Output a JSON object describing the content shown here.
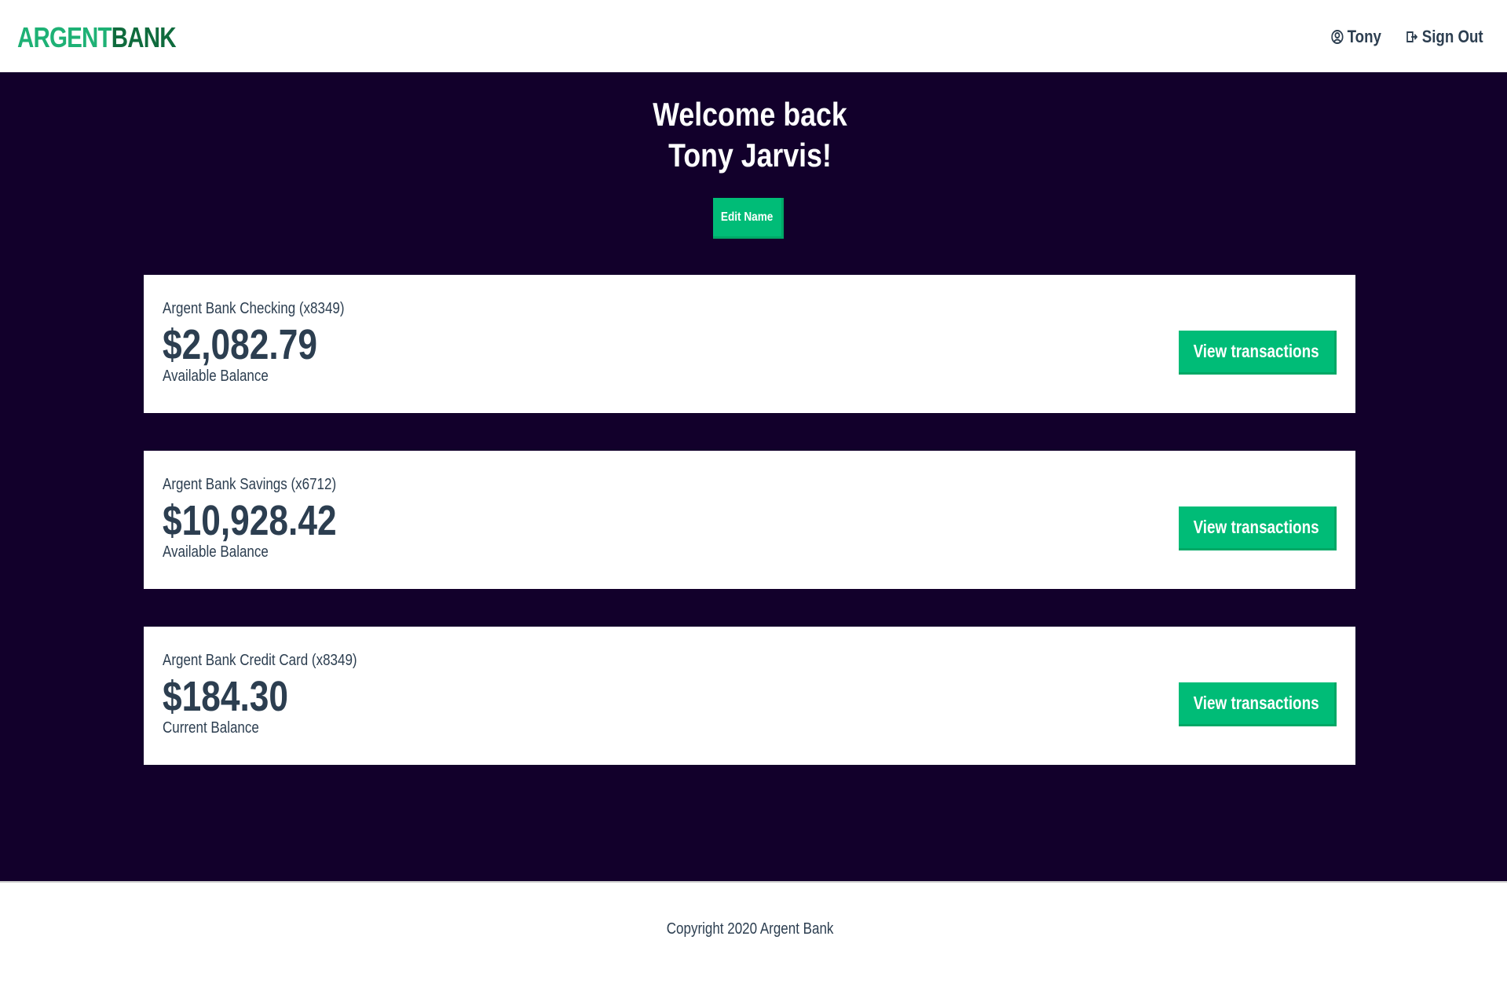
{
  "brand": {
    "logo_part1": "ARGENT",
    "logo_part2": "BANK",
    "accent_color": "#00bc77",
    "background_color": "#12002b"
  },
  "header": {
    "user_label": "Tony",
    "user_icon": "user-circle-icon",
    "sign_out_label": "Sign Out",
    "sign_out_icon": "sign-out-icon"
  },
  "welcome": {
    "line1": "Welcome back",
    "line2": "Tony Jarvis!",
    "edit_button_label": "Edit Name"
  },
  "accounts": [
    {
      "title": "Argent Bank Checking (x8349)",
      "amount": "$2,082.79",
      "description": "Available Balance",
      "button_label": "View transactions"
    },
    {
      "title": "Argent Bank Savings (x6712)",
      "amount": "$10,928.42",
      "description": "Available Balance",
      "button_label": "View transactions"
    },
    {
      "title": "Argent Bank Credit Card (x8349)",
      "amount": "$184.30",
      "description": "Current Balance",
      "button_label": "View transactions"
    }
  ],
  "footer": {
    "copyright": "Copyright 2020 Argent Bank"
  }
}
